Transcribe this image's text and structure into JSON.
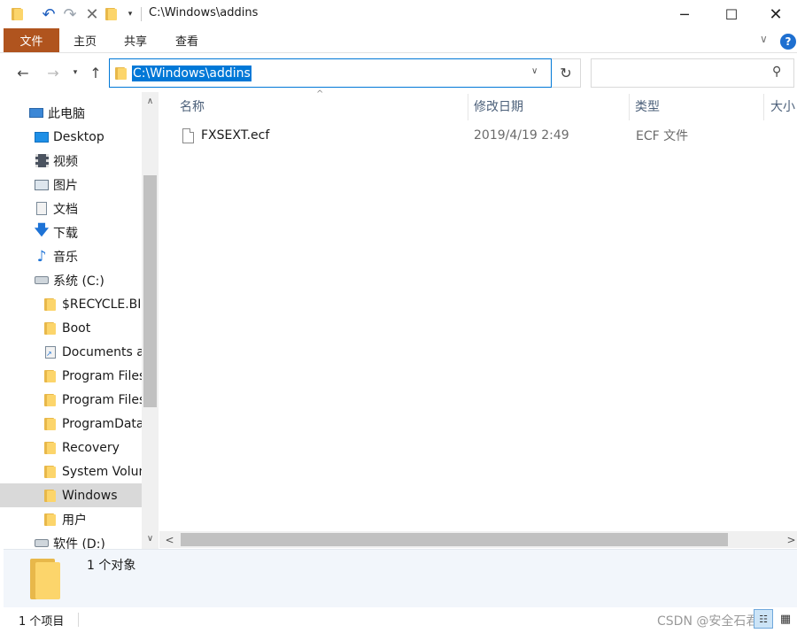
{
  "window": {
    "title": "C:\\Windows\\addins",
    "minimize_glyph": "─",
    "maximize_glyph": "☐",
    "close_glyph": "✕"
  },
  "quick_access": {
    "undo_glyph": "↶",
    "redo_glyph": "↷",
    "delete_glyph": "✕",
    "dropdown_glyph": "▾"
  },
  "ribbon": {
    "tabs": [
      "文件",
      "主页",
      "共享",
      "查看"
    ],
    "chevron_glyph": "∨",
    "help_glyph": "?"
  },
  "nav": {
    "back_glyph": "←",
    "forward_glyph": "→",
    "recent_glyph": "▾",
    "up_glyph": "↑",
    "address": "C:\\Windows\\addins",
    "address_dropdown_glyph": "∨",
    "refresh_glyph": "↻",
    "search_placeholder": "",
    "search_glyph": "⚲"
  },
  "tree": [
    {
      "label": "此电脑",
      "icon": "computer-icon"
    },
    {
      "label": "Desktop",
      "icon": "desktop-icon"
    },
    {
      "label": "视频",
      "icon": "video-icon"
    },
    {
      "label": "图片",
      "icon": "pictures-icon"
    },
    {
      "label": "文档",
      "icon": "documents-icon"
    },
    {
      "label": "下载",
      "icon": "download-icon"
    },
    {
      "label": "音乐",
      "icon": "music-icon"
    },
    {
      "label": "系统 (C:)",
      "icon": "drive-icon"
    },
    {
      "label": "$RECYCLE.BIN",
      "icon": "folder-icon"
    },
    {
      "label": "Boot",
      "icon": "folder-icon"
    },
    {
      "label": "Documents ar",
      "icon": "shortcut-folder-icon"
    },
    {
      "label": "Program Files",
      "icon": "folder-icon"
    },
    {
      "label": "Program Files",
      "icon": "folder-icon"
    },
    {
      "label": "ProgramData",
      "icon": "folder-icon"
    },
    {
      "label": "Recovery",
      "icon": "folder-icon"
    },
    {
      "label": "System Volum",
      "icon": "folder-icon"
    },
    {
      "label": "Windows",
      "icon": "folder-icon",
      "selected": true
    },
    {
      "label": "用户",
      "icon": "folder-icon"
    },
    {
      "label": "软件 (D:)",
      "icon": "drive-icon"
    }
  ],
  "columns": [
    "名称",
    "修改日期",
    "类型",
    "大小"
  ],
  "files": [
    {
      "name": "FXSEXT.ecf",
      "modified": "2019/4/19 2:49",
      "type": "ECF 文件"
    }
  ],
  "scroll": {
    "up_glyph": "∧",
    "down_glyph": "∨",
    "left_glyph": "<",
    "right_glyph": ">",
    "sort_glyph": "^"
  },
  "details": {
    "text": "1 个对象"
  },
  "status": {
    "item_count": "1 个项目",
    "watermark": "CSDN @安全石君",
    "details_view_glyph": "☷",
    "icons_view_glyph": "▦"
  },
  "colors": {
    "accent": "#0078d7",
    "file_tab": "#b0541e",
    "selected_row": "#d9d9d9",
    "folder": "#fcd56b"
  }
}
